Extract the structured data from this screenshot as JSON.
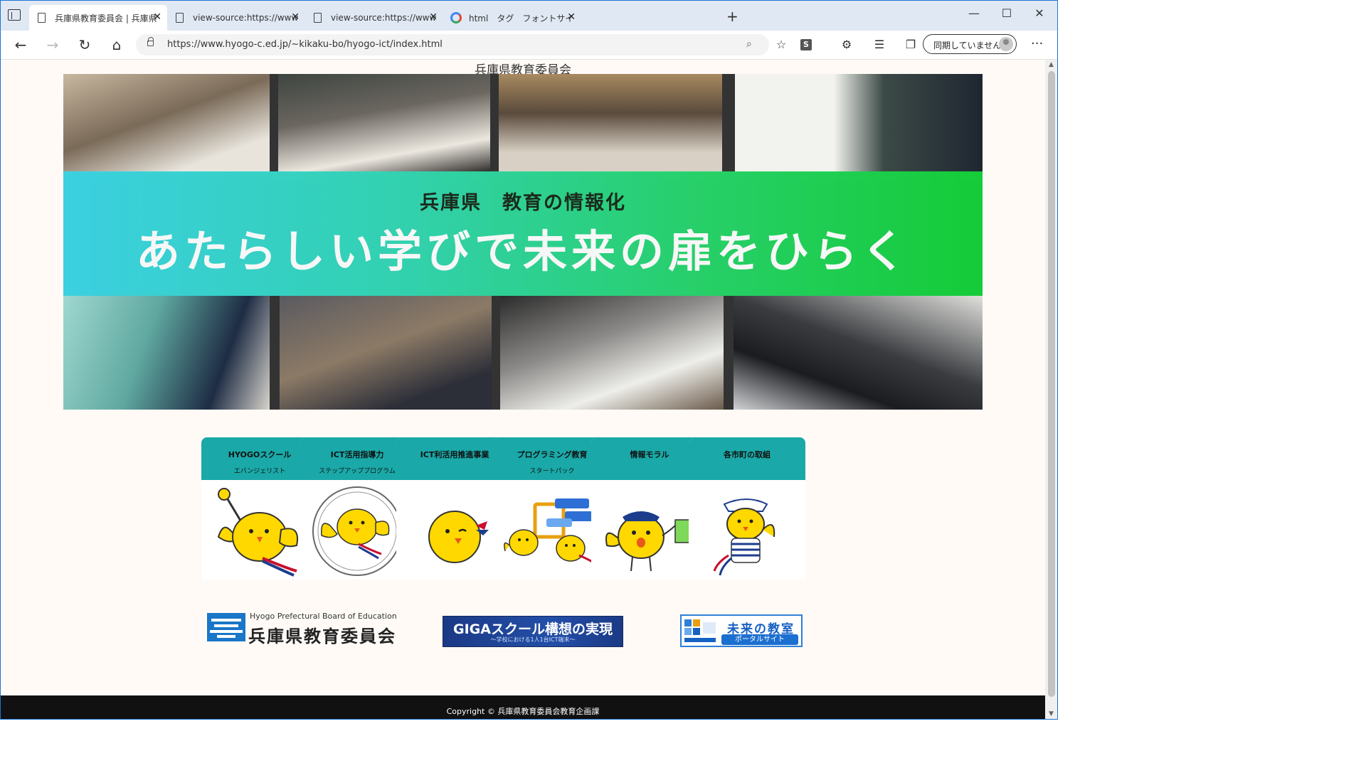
{
  "browser": {
    "tabs": [
      {
        "label": "兵庫県教育委員会 | 兵庫県 教育",
        "active": true,
        "icon": "document-icon"
      },
      {
        "label": "view-source:https://www.hyogo-",
        "active": false,
        "icon": "document-icon"
      },
      {
        "label": "view-source:https://www.hyogo-",
        "active": false,
        "icon": "document-icon"
      },
      {
        "label": "html　タグ　フォントサイズ - Googl",
        "active": false,
        "icon": "google-icon"
      }
    ],
    "new_tab": "+",
    "window_controls": {
      "minimize": "—",
      "maximize": "☐",
      "close": "✕"
    },
    "nav": {
      "back": "←",
      "forward": "→",
      "reload": "↻",
      "home": "⌂"
    },
    "url": "https://www.hyogo-c.ed.jp/~kikaku-bo/hyogo-ict/index.html",
    "toolbar_icons": [
      "zoom-icon",
      "favorite-add-icon",
      "s-extension-icon",
      "extensions-icon",
      "favorites-icon",
      "collections-icon"
    ],
    "s_badge": "S",
    "sync_label": "同期していません",
    "more": "···"
  },
  "page": {
    "org_header": "兵庫県教育委員会",
    "banner_sub": "兵庫県　教育の情報化",
    "banner_main": "あたらしい学びで未来の扉をひらく",
    "cards": [
      {
        "title": "HYOGOスクール",
        "sub": "エバンジェリスト",
        "mascot": "mascot-with-baton"
      },
      {
        "title": "ICT活用指導力",
        "sub": "ステップアッププログラム",
        "mascot": "mascot-emblem"
      },
      {
        "title": "ICT利活用推進事業",
        "sub": "",
        "mascot": "mascot-winking"
      },
      {
        "title": "プログラミング教育",
        "sub": "スタートパック",
        "mascot": "mascot-programming"
      },
      {
        "title": "情報モラル",
        "sub": "",
        "mascot": "mascot-police-flag"
      },
      {
        "title": "各市町の取組",
        "sub": "",
        "mascot": "mascot-sailor"
      }
    ],
    "links": {
      "hyogo_small": "Hyogo Prefectural Board of Education",
      "hyogo_big": "兵庫県教育委員会",
      "giga_main": "GIGAスクール構想の実現",
      "giga_sub": "〜学校における1人1台ICT端末〜",
      "mirai_main": "未来の教室",
      "mirai_sub": "ポータルサイト"
    },
    "footer": "Copyright ©  兵庫県教育委員会教育企画課"
  },
  "colors": {
    "card_header": "#1aa8a8",
    "banner_left": "#3cd6e8",
    "banner_right": "#14d238",
    "footer_bg": "#111111",
    "page_bg": "#fffaf6"
  }
}
